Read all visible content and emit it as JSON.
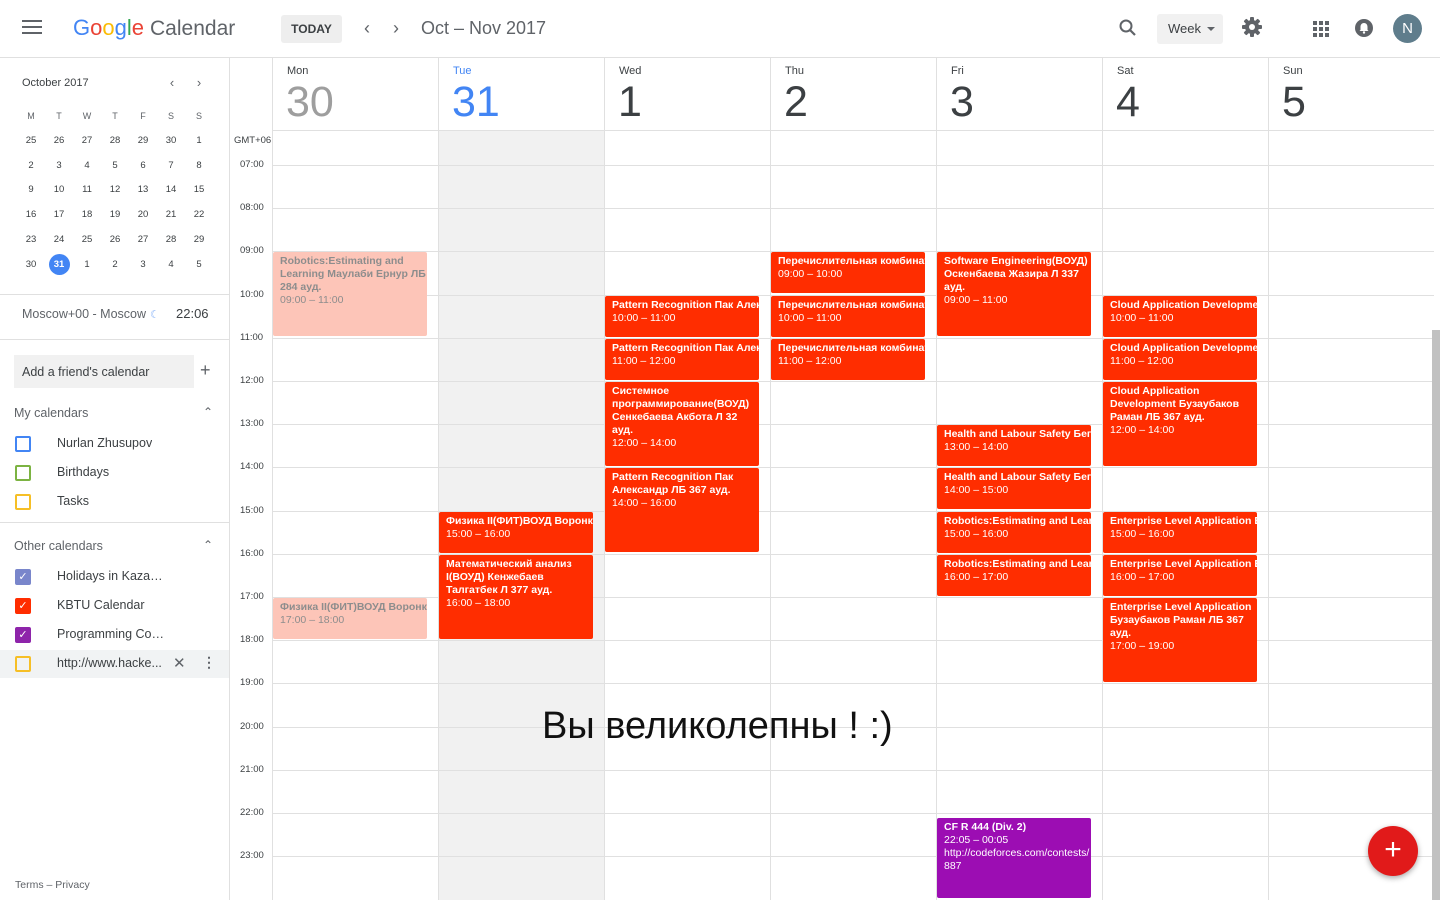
{
  "header": {
    "logo_google": "Google",
    "logo_product": "Calendar",
    "today_label": "TODAY",
    "range_title": "Oct – Nov 2017",
    "view_label": "Week",
    "avatar_initial": "N",
    "logo_colors": [
      "#4285f4",
      "#ea4335",
      "#fbbc05",
      "#4285f4",
      "#34a853",
      "#ea4335"
    ]
  },
  "mini_calendar": {
    "title": "October 2017",
    "weekdays": [
      "M",
      "T",
      "W",
      "T",
      "F",
      "S",
      "S"
    ],
    "weeks": [
      [
        "25",
        "26",
        "27",
        "28",
        "29",
        "30",
        "1"
      ],
      [
        "2",
        "3",
        "4",
        "5",
        "6",
        "7",
        "8"
      ],
      [
        "9",
        "10",
        "11",
        "12",
        "13",
        "14",
        "15"
      ],
      [
        "16",
        "17",
        "18",
        "19",
        "20",
        "21",
        "22"
      ],
      [
        "23",
        "24",
        "25",
        "26",
        "27",
        "28",
        "29"
      ],
      [
        "30",
        "31",
        "1",
        "2",
        "3",
        "4",
        "5"
      ]
    ],
    "today": "31",
    "accent": "#4285f4"
  },
  "sidebar": {
    "timezone_label": "Moscow+00 - Moscow",
    "timezone_time": "22:06",
    "add_friend_placeholder": "Add a friend's calendar",
    "my_calendars_title": "My calendars",
    "my_calendars": [
      {
        "label": "Nurlan Zhusupov",
        "color": "#4285f4",
        "checked": false
      },
      {
        "label": "Birthdays",
        "color": "#7cb342",
        "checked": false
      },
      {
        "label": "Tasks",
        "color": "#f6bf26",
        "checked": false
      }
    ],
    "other_calendars_title": "Other calendars",
    "other_calendars": [
      {
        "label": "Holidays in Kazakhstan",
        "color": "#7986cb",
        "checked": true
      },
      {
        "label": "KBTU Calendar",
        "color": "#ff2d00",
        "checked": true
      },
      {
        "label": "Programming Contests Cal...",
        "color": "#8e24aa",
        "checked": true
      },
      {
        "label": "http://www.hacke...",
        "color": "#f6bf26",
        "checked": false
      }
    ],
    "footer_terms": "Terms",
    "footer_sep": "–",
    "footer_privacy": "Privacy"
  },
  "week": {
    "timezone_label": "GMT+06",
    "days": [
      {
        "name": "Mon",
        "num": "30",
        "state": "past"
      },
      {
        "name": "Tue",
        "num": "31",
        "state": "today"
      },
      {
        "name": "Wed",
        "num": "1",
        "state": "future"
      },
      {
        "name": "Thu",
        "num": "2",
        "state": "future"
      },
      {
        "name": "Fri",
        "num": "3",
        "state": "future"
      },
      {
        "name": "Sat",
        "num": "4",
        "state": "future"
      },
      {
        "name": "Sun",
        "num": "5",
        "state": "future"
      }
    ],
    "hours": [
      "07:00",
      "08:00",
      "09:00",
      "10:00",
      "11:00",
      "12:00",
      "13:00",
      "14:00",
      "15:00",
      "16:00",
      "17:00",
      "18:00",
      "19:00",
      "20:00",
      "21:00",
      "22:00",
      "23:00"
    ]
  },
  "event_colors": {
    "kbtu": "#ff2d00",
    "kbtu_past": "#fdc5b8",
    "contest": "#9c0db3"
  },
  "events": [
    {
      "day": 0,
      "start": 9,
      "end": 11,
      "title": "Robotics:Estimating and Learning Маулаби Ернур ЛБ 284 ауд.",
      "time": "09:00 – 11:00",
      "color": "kbtu_past",
      "faded": true
    },
    {
      "day": 0,
      "start": 17,
      "end": 18,
      "title": "Физика II(ФИТ)ВОУД Воронкова",
      "time": "17:00 – 18:00",
      "color": "kbtu_past",
      "faded": true
    },
    {
      "day": 1,
      "start": 15,
      "end": 16,
      "title": "Физика II(ФИТ)ВОУД Воронкова",
      "time": "15:00 – 16:00",
      "color": "kbtu"
    },
    {
      "day": 1,
      "start": 16,
      "end": 18,
      "title": "Математический анализ I(ВОУД) Кенжебаев Талгатбек Л 377 ауд.",
      "time": "16:00 – 18:00",
      "color": "kbtu"
    },
    {
      "day": 2,
      "start": 10,
      "end": 11,
      "title": "Pattern Recognition Пак Александр",
      "time": "10:00 – 11:00",
      "color": "kbtu"
    },
    {
      "day": 2,
      "start": 11,
      "end": 12,
      "title": "Pattern Recognition Пак Александр",
      "time": "11:00 – 12:00",
      "color": "kbtu"
    },
    {
      "day": 2,
      "start": 12,
      "end": 14,
      "title": "Системное программирование(ВОУД) Сенкебаева Акбота Л 32 ауд.",
      "time": "12:00 – 14:00",
      "color": "kbtu"
    },
    {
      "day": 2,
      "start": 14,
      "end": 16,
      "title": "Pattern Recognition Пак Александр ЛБ 367 ауд.",
      "time": "14:00 – 16:00",
      "color": "kbtu"
    },
    {
      "day": 3,
      "start": 9,
      "end": 10,
      "title": "Перечислительная комбинаторика",
      "time": "09:00 – 10:00",
      "color": "kbtu"
    },
    {
      "day": 3,
      "start": 10,
      "end": 11,
      "title": "Перечислительная комбинаторика",
      "time": "10:00 – 11:00",
      "color": "kbtu"
    },
    {
      "day": 3,
      "start": 11,
      "end": 12,
      "title": "Перечислительная комбинаторика",
      "time": "11:00 – 12:00",
      "color": "kbtu"
    },
    {
      "day": 4,
      "start": 9,
      "end": 11,
      "title": "Software Engineering(ВОУД) Оскенбаева Жазира Л 337 ауд.",
      "time": "09:00 – 11:00",
      "color": "kbtu"
    },
    {
      "day": 4,
      "start": 13,
      "end": 14,
      "title": "Health and Labour Safety Бегимбетова",
      "time": "13:00 – 14:00",
      "color": "kbtu"
    },
    {
      "day": 4,
      "start": 14,
      "end": 15,
      "title": "Health and Labour Safety Бегимбетова",
      "time": "14:00 – 15:00",
      "color": "kbtu"
    },
    {
      "day": 4,
      "start": 15,
      "end": 16,
      "title": "Robotics:Estimating and Learning",
      "time": "15:00 – 16:00",
      "color": "kbtu"
    },
    {
      "day": 4,
      "start": 16,
      "end": 17,
      "title": "Robotics:Estimating and Learning",
      "time": "16:00 – 17:00",
      "color": "kbtu"
    },
    {
      "day": 4,
      "start": 22.083,
      "end": 24.0,
      "title": "CF R 444 (Div. 2)",
      "time": "22:05 – 00:05",
      "desc": "http://codeforces.com/contests/887",
      "color": "contest"
    },
    {
      "day": 5,
      "start": 10,
      "end": 11,
      "title": "Cloud Application Development",
      "time": "10:00 – 11:00",
      "color": "kbtu"
    },
    {
      "day": 5,
      "start": 11,
      "end": 12,
      "title": "Cloud Application Development",
      "time": "11:00 – 12:00",
      "color": "kbtu"
    },
    {
      "day": 5,
      "start": 12,
      "end": 14,
      "title": "Cloud Application Development Бузаубаков Раман ЛБ 367 ауд.",
      "time": "12:00 – 14:00",
      "color": "kbtu"
    },
    {
      "day": 5,
      "start": 15,
      "end": 16,
      "title": "Enterprise Level Application Бузаубаков",
      "time": "15:00 – 16:00",
      "color": "kbtu"
    },
    {
      "day": 5,
      "start": 16,
      "end": 17,
      "title": "Enterprise Level Application Бузаубаков",
      "time": "16:00 – 17:00",
      "color": "kbtu"
    },
    {
      "day": 5,
      "start": 17,
      "end": 19,
      "title": "Enterprise Level Application Бузаубаков Раман ЛБ 367 ауд.",
      "time": "17:00 – 19:00",
      "color": "kbtu"
    }
  ],
  "overlay_text": "Вы великолепны ! :)",
  "fab_label": "+"
}
